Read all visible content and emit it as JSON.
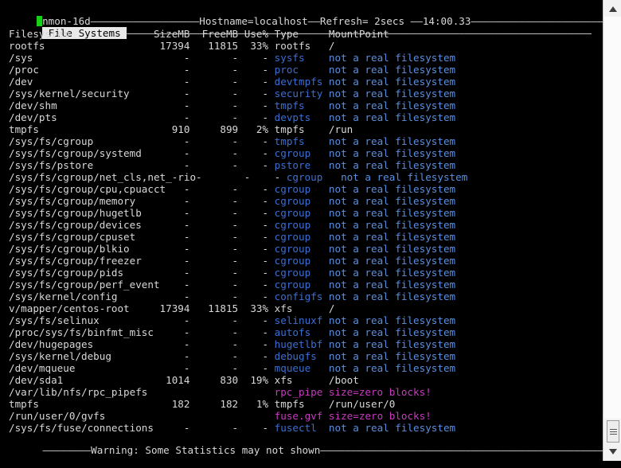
{
  "header": {
    "app": "nmon-16d",
    "hostname_label": "Hostname=localhost",
    "refresh_label": "Refresh= 2secs",
    "time": "14:00.33",
    "dash_1": "——————————————————",
    "dash_2": "——",
    "dash_3": " ——",
    "dash_4": "————————————————————————————————————————————————————————"
  },
  "panel": {
    "tab_label": " File Systems ",
    "tab_dash": "—————————————————————————————————————————————————————————————————————————————"
  },
  "table": {
    "columns": [
      "Filesystem",
      "SizeMB",
      "FreeMB",
      "Use%",
      "Type",
      "MountPoint"
    ],
    "rows": [
      {
        "name": "rootfs",
        "size": "17394",
        "free": "11815",
        "use": "33%",
        "type": "rootfs",
        "mount": "/",
        "style": "white"
      },
      {
        "name": "/sys",
        "size": "-",
        "free": "-",
        "use": "-",
        "type": "sysfs",
        "mount": "not a real filesystem",
        "style": "blue"
      },
      {
        "name": "/proc",
        "size": "-",
        "free": "-",
        "use": "-",
        "type": "proc",
        "mount": "not a real filesystem",
        "style": "blue"
      },
      {
        "name": "/dev",
        "size": "-",
        "free": "-",
        "use": "-",
        "type": "devtmpfs",
        "mount": "not a real filesystem",
        "style": "blue"
      },
      {
        "name": "/sys/kernel/security",
        "size": "-",
        "free": "-",
        "use": "-",
        "type": "security",
        "mount": "not a real filesystem",
        "style": "blue"
      },
      {
        "name": "/dev/shm",
        "size": "-",
        "free": "-",
        "use": "-",
        "type": "tmpfs",
        "mount": "not a real filesystem",
        "style": "blue"
      },
      {
        "name": "/dev/pts",
        "size": "-",
        "free": "-",
        "use": "-",
        "type": "devpts",
        "mount": "not a real filesystem",
        "style": "blue"
      },
      {
        "name": "tmpfs",
        "size": "910",
        "free": "899",
        "use": "2%",
        "type": "tmpfs",
        "mount": "/run",
        "style": "white"
      },
      {
        "name": "/sys/fs/cgroup",
        "size": "-",
        "free": "-",
        "use": "-",
        "type": "tmpfs",
        "mount": "not a real filesystem",
        "style": "blue"
      },
      {
        "name": "/sys/fs/cgroup/systemd",
        "size": "-",
        "free": "-",
        "use": "-",
        "type": "cgroup",
        "mount": "not a real filesystem",
        "style": "blue"
      },
      {
        "name": "/sys/fs/pstore",
        "size": "-",
        "free": "-",
        "use": "-",
        "type": "pstore",
        "mount": "not a real filesystem",
        "style": "blue"
      },
      {
        "name": "/sys/fs/cgroup/net_cls,net_-rio",
        "size": "-",
        "free": "-",
        "use": "-",
        "type": "cgroup",
        "mount": "not a real filesystem",
        "style": "blue"
      },
      {
        "name": "/sys/fs/cgroup/cpu,cpuacct",
        "size": "-",
        "free": "-",
        "use": "-",
        "type": "cgroup",
        "mount": "not a real filesystem",
        "style": "blue"
      },
      {
        "name": "/sys/fs/cgroup/memory",
        "size": "-",
        "free": "-",
        "use": "-",
        "type": "cgroup",
        "mount": "not a real filesystem",
        "style": "blue"
      },
      {
        "name": "/sys/fs/cgroup/hugetlb",
        "size": "-",
        "free": "-",
        "use": "-",
        "type": "cgroup",
        "mount": "not a real filesystem",
        "style": "blue"
      },
      {
        "name": "/sys/fs/cgroup/devices",
        "size": "-",
        "free": "-",
        "use": "-",
        "type": "cgroup",
        "mount": "not a real filesystem",
        "style": "blue"
      },
      {
        "name": "/sys/fs/cgroup/cpuset",
        "size": "-",
        "free": "-",
        "use": "-",
        "type": "cgroup",
        "mount": "not a real filesystem",
        "style": "blue"
      },
      {
        "name": "/sys/fs/cgroup/blkio",
        "size": "-",
        "free": "-",
        "use": "-",
        "type": "cgroup",
        "mount": "not a real filesystem",
        "style": "blue"
      },
      {
        "name": "/sys/fs/cgroup/freezer",
        "size": "-",
        "free": "-",
        "use": "-",
        "type": "cgroup",
        "mount": "not a real filesystem",
        "style": "blue"
      },
      {
        "name": "/sys/fs/cgroup/pids",
        "size": "-",
        "free": "-",
        "use": "-",
        "type": "cgroup",
        "mount": "not a real filesystem",
        "style": "blue"
      },
      {
        "name": "/sys/fs/cgroup/perf_event",
        "size": "-",
        "free": "-",
        "use": "-",
        "type": "cgroup",
        "mount": "not a real filesystem",
        "style": "blue"
      },
      {
        "name": "/sys/kernel/config",
        "size": "-",
        "free": "-",
        "use": "-",
        "type": "configfs",
        "mount": "not a real filesystem",
        "style": "blue"
      },
      {
        "name": "v/mapper/centos-root",
        "size": "17394",
        "free": "11815",
        "use": "33%",
        "type": "xfs",
        "mount": "/",
        "style": "white"
      },
      {
        "name": "/sys/fs/selinux",
        "size": "-",
        "free": "-",
        "use": "-",
        "type": "selinuxf",
        "mount": "not a real filesystem",
        "style": "blue"
      },
      {
        "name": "/proc/sys/fs/binfmt_misc",
        "size": "-",
        "free": "-",
        "use": "-",
        "type": "autofs",
        "mount": "not a real filesystem",
        "style": "blue"
      },
      {
        "name": "/dev/hugepages",
        "size": "-",
        "free": "-",
        "use": "-",
        "type": "hugetlbf",
        "mount": "not a real filesystem",
        "style": "blue"
      },
      {
        "name": "/sys/kernel/debug",
        "size": "-",
        "free": "-",
        "use": "-",
        "type": "debugfs",
        "mount": "not a real filesystem",
        "style": "blue"
      },
      {
        "name": "/dev/mqueue",
        "size": "-",
        "free": "-",
        "use": "-",
        "type": "mqueue",
        "mount": "not a real filesystem",
        "style": "blue"
      },
      {
        "name": "/dev/sda1",
        "size": "1014",
        "free": "830",
        "use": "19%",
        "type": "xfs",
        "mount": "/boot",
        "style": "white"
      },
      {
        "name": "/var/lib/nfs/rpc_pipefs",
        "size": "",
        "free": "",
        "use": "",
        "type": "rpc_pipe",
        "mount": "size=zero blocks!",
        "style": "magenta"
      },
      {
        "name": "tmpfs",
        "size": "182",
        "free": "182",
        "use": "1%",
        "type": "tmpfs",
        "mount": "/run/user/0",
        "style": "white"
      },
      {
        "name": "/run/user/0/gvfs",
        "size": "",
        "free": "",
        "use": "",
        "type": "fuse.gvf",
        "mount": "size=zero blocks!",
        "style": "magenta"
      },
      {
        "name": "/sys/fs/fuse/connections",
        "size": "-",
        "free": "-",
        "use": "-",
        "type": "fusectl",
        "mount": "not a real filesystem",
        "style": "blue"
      }
    ]
  },
  "footer": {
    "warning": "Warning: Some Statistics may not shown",
    "dash_left": "————————",
    "dash_right": "——————————————————————————————————————————————————————————————————"
  },
  "scrollbar": {
    "up_icon": "scroll-up-arrow",
    "down_icon": "scroll-down-arrow"
  },
  "colors": {
    "background": "#000000",
    "foreground": "#d8d8d8",
    "blue": "#3b6fd4",
    "light_blue": "#5a8fe0",
    "magenta": "#c93ac0",
    "cursor_green": "#18d018"
  }
}
